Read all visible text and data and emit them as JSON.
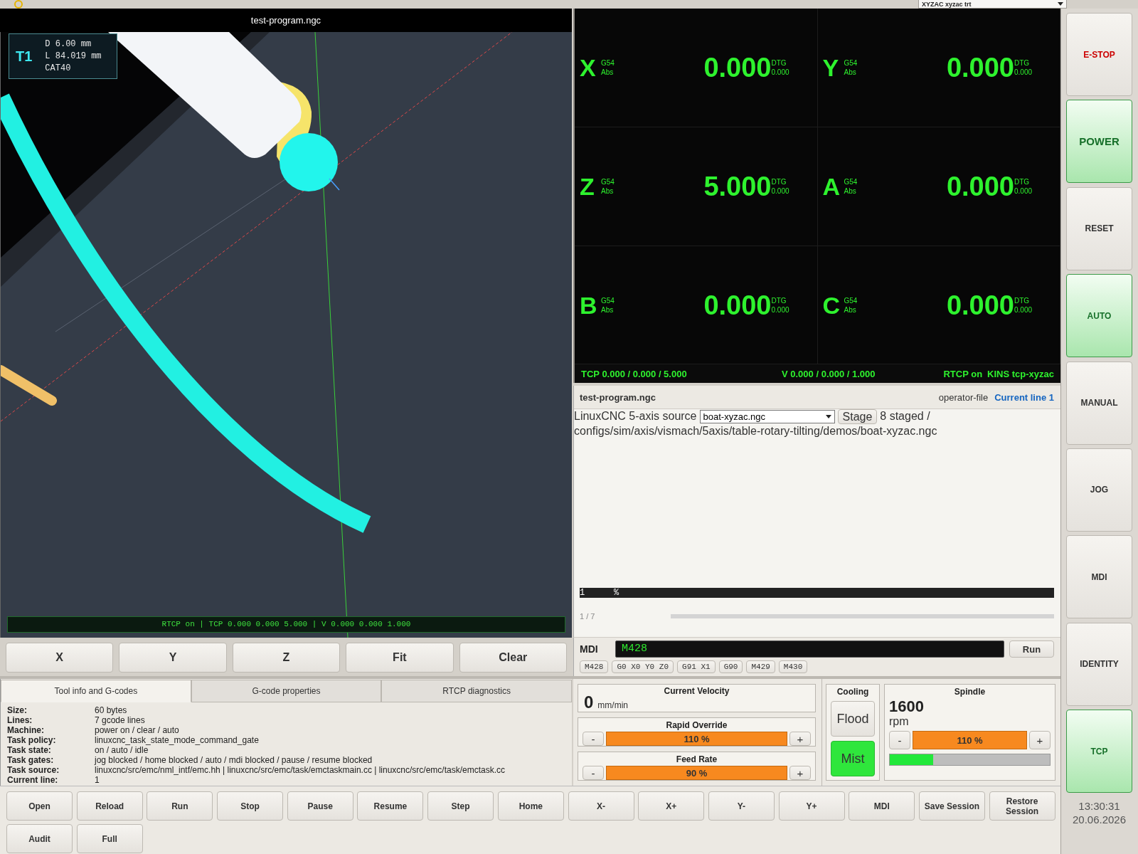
{
  "top_bar": {
    "machine_select": "XYZAC xyzac trt"
  },
  "viewport": {
    "title": "test-program.ngc",
    "tool": {
      "number": "T1",
      "lines": [
        "D 6.00 mm",
        "L 84.019 mm",
        "CAT40"
      ]
    },
    "status": "RTCP on | TCP 0.000 0.000 5.000 | V 0.000 0.000 1.000"
  },
  "view_buttons": [
    "X",
    "Y",
    "Z",
    "Fit",
    "Clear"
  ],
  "dro": {
    "axes": [
      {
        "axis": "X",
        "offset": "G54",
        "mode": "Abs",
        "value": "0.000",
        "dtg_label": "DTG",
        "dtg": "0.000"
      },
      {
        "axis": "Y",
        "offset": "G54",
        "mode": "Abs",
        "value": "0.000",
        "dtg_label": "DTG",
        "dtg": "0.000"
      },
      {
        "axis": "Z",
        "offset": "G54",
        "mode": "Abs",
        "value": "5.000",
        "dtg_label": "DTG",
        "dtg": "0.000"
      },
      {
        "axis": "A",
        "offset": "G54",
        "mode": "Abs",
        "value": "0.000",
        "dtg_label": "DTG",
        "dtg": "0.000"
      },
      {
        "axis": "B",
        "offset": "G54",
        "mode": "Abs",
        "value": "0.000",
        "dtg_label": "DTG",
        "dtg": "0.000"
      },
      {
        "axis": "C",
        "offset": "G54",
        "mode": "Abs",
        "value": "0.000",
        "dtg_label": "DTG",
        "dtg": "0.000"
      }
    ],
    "footer": {
      "tcp": "TCP 0.000 / 0.000 / 5.000",
      "velocity": "V 0.000 / 0.000 / 1.000",
      "rtcp": "RTCP on",
      "kins": "KINS tcp-xyzac"
    }
  },
  "program": {
    "file": "test-program.ngc",
    "source": "operator-file",
    "current_line": "Current line 1",
    "source_label": "LinuxCNC 5-axis source",
    "source_select": "boat-xyzac.ngc",
    "stage_button": "Stage",
    "staged_text": "8 staged /",
    "staged_path": "configs/sim/axis/vismach/5axis/table-rotary-tilting/demos/boat-xyzac.ngc",
    "code_lines": [
      {
        "number": "1",
        "text": "%",
        "selected": true
      }
    ],
    "position": "1 / 7"
  },
  "mdi": {
    "label": "MDI",
    "value": "M428",
    "run_button": "Run",
    "history": [
      "M428",
      "G0 X0 Y0 Z0",
      "G91 X1",
      "G90",
      "M429",
      "M430"
    ]
  },
  "info": {
    "tabs": [
      {
        "label": "Tool info and G-codes",
        "selected": true
      },
      {
        "label": "G-code properties",
        "selected": false
      },
      {
        "label": "RTCP diagnostics",
        "selected": false
      }
    ],
    "rows": [
      {
        "key": "Size:",
        "value": "60 bytes"
      },
      {
        "key": "Lines:",
        "value": "7 gcode lines"
      },
      {
        "key": "Machine:",
        "value": "power on / clear / auto"
      },
      {
        "key": "Task policy:",
        "value": "linuxcnc_task_state_mode_command_gate"
      },
      {
        "key": "Task state:",
        "value": "on / auto / idle"
      },
      {
        "key": "Task gates:",
        "value": "jog blocked / home blocked / auto / mdi blocked / pause / resume blocked"
      },
      {
        "key": "Task source:",
        "value": "linuxcnc/src/emc/nml_intf/emc.hh | linuxcnc/src/emc/task/emctaskmain.cc | linuxcnc/src/emc/task/emctask.cc"
      },
      {
        "key": "Current line:",
        "value": "1"
      }
    ]
  },
  "velocity": {
    "title": "Current Velocity",
    "value": "0",
    "unit": "mm/min"
  },
  "overrides": [
    {
      "title": "Rapid Override",
      "minus": "-",
      "reading": "110 %",
      "plus": "+"
    },
    {
      "title": "Feed Rate",
      "minus": "-",
      "reading": "90 %",
      "plus": "+"
    }
  ],
  "cooling": {
    "title": "Cooling",
    "buttons": [
      {
        "label": "Flood",
        "on": false
      },
      {
        "label": "Mist",
        "on": true
      }
    ]
  },
  "spindle": {
    "title": "Spindle",
    "speed": "1600",
    "unit": "rpm",
    "minus": "-",
    "reading": "110 %",
    "plus": "+",
    "load": {
      "level": 0.27
    }
  },
  "actions": [
    "Open",
    "Reload",
    "Run",
    "Stop",
    "Pause",
    "Resume",
    "Step",
    "Home",
    "X-",
    "X+",
    "Y-",
    "Y+",
    "MDI",
    "Save Session",
    "Restore Session",
    "Audit",
    "Full"
  ],
  "sidebar": {
    "buttons": [
      {
        "label": "E-STOP",
        "kind": "estop",
        "on": false
      },
      {
        "label": "POWER",
        "kind": "power",
        "on": true
      },
      {
        "label": "RESET",
        "kind": "mode",
        "on": false
      },
      {
        "label": "AUTO",
        "kind": "mode",
        "on": true
      },
      {
        "label": "MANUAL",
        "kind": "mode",
        "on": false
      },
      {
        "label": "JOG",
        "kind": "mode",
        "on": false
      },
      {
        "label": "MDI",
        "kind": "mode",
        "on": false
      },
      {
        "label": "IDENTITY",
        "kind": "mode",
        "on": false
      },
      {
        "label": "TCP",
        "kind": "mode",
        "on": true
      }
    ],
    "time": "13:30:31",
    "date": "20.06.2026"
  }
}
